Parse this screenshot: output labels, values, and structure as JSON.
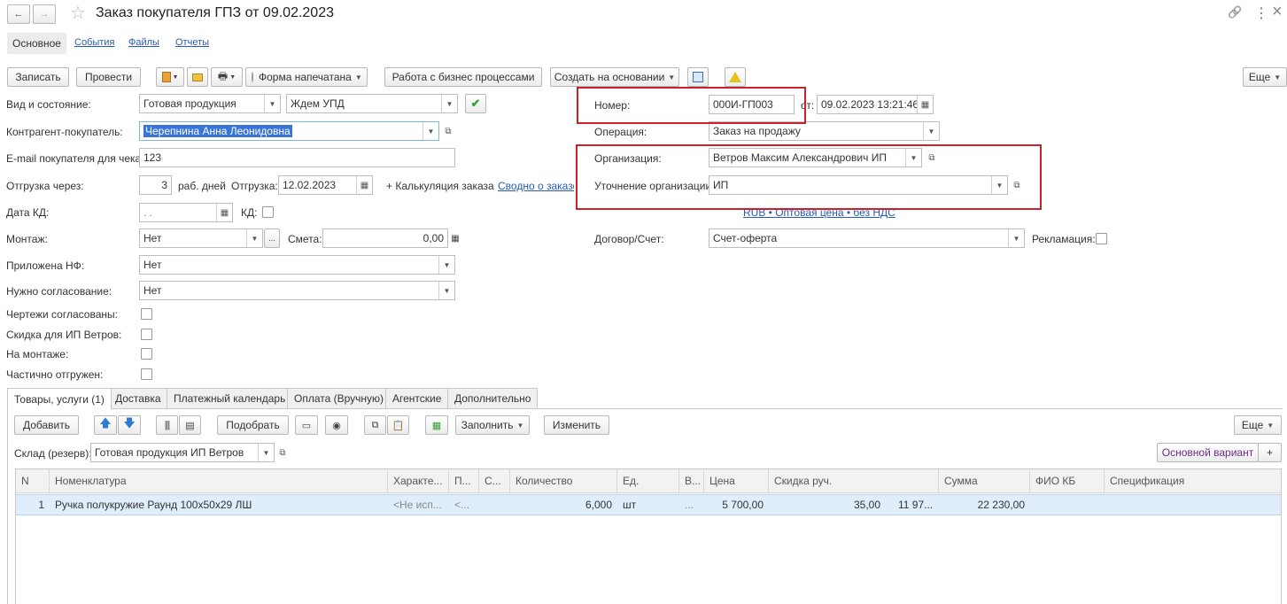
{
  "title": "Заказ покупателя ГПЗ от 09.02.2023",
  "nav": {
    "back": "←",
    "forward": "→",
    "star": "☆",
    "link": "🔗",
    "more": "⋮",
    "close": "×"
  },
  "section_tabs": [
    "Основное",
    "События",
    "Файлы",
    "Отчеты"
  ],
  "toolbar": {
    "write": "Записать",
    "post": "Провести",
    "print_form": "Форма напечатана",
    "business": "Работа с бизнес процессами",
    "create_based": "Создать на основании",
    "more": "Еще"
  },
  "form": {
    "vid_label": "Вид и состояние:",
    "vid_value": "Готовая продукция",
    "state_value": "Ждем УПД",
    "contragent_label": "Контрагент-покупатель:",
    "contragent_value": "Черепнина Анна Леонидовна",
    "email_label": "E-mail покупателя для чека:",
    "email_value": "123",
    "otgr_label": "Отгрузка через:",
    "otgr_days": "3",
    "otgr_days_unit": "раб. дней",
    "otgr_date_label": "Отгрузка:",
    "otgr_date": "12.02.2023",
    "calc_link": "+ Калькуляция заказа",
    "summary_link": "Сводно о заказе",
    "kd_date_label": "Дата КД:",
    "kd_date_value": " .  .",
    "kd_label": "КД:",
    "montazh_label": "Монтаж:",
    "montazh_value": "Нет",
    "smeta_label": "Смета:",
    "smeta_value": "0,00",
    "nf_label": "Приложена НФ:",
    "nf_value": "Нет",
    "soglas_label": "Нужно согласование:",
    "soglas_value": "Нет",
    "chertezhi_label": "Чертежи согласованы:",
    "skidka_label": "Скидка для ИП Ветров:",
    "na_montazhe_label": "На монтаже:",
    "chast_label": "Частично отгружен:",
    "nomer_label": "Номер:",
    "nomer_value": "000И-ГП003",
    "ot_label": "от:",
    "ot_value": "09.02.2023 13:21:46",
    "operation_label": "Операция:",
    "operation_value": "Заказ на продажу",
    "org_label": "Организация:",
    "org_value": "Ветров Максим Александрович ИП",
    "utoch_label": "Уточнение организации:",
    "utoch_value": "ИП",
    "price_link": "RUB • Оптовая цена • без НДС",
    "dogovor_label": "Договор/Счет:",
    "dogovor_value": "Счет-оферта",
    "reklam_label": "Рекламация:"
  },
  "tabs": [
    "Товары, услуги (1)",
    "Доставка",
    "Платежный календарь",
    "Оплата (Вручную)",
    "Агентские",
    "Дополнительно"
  ],
  "items_toolbar": {
    "add": "Добавить",
    "pick": "Подобрать",
    "fill": "Заполнить",
    "change": "Изменить",
    "more": "Еще"
  },
  "sklad": {
    "label": "Склад (резерв):",
    "value": "Готовая продукция ИП Ветров"
  },
  "variant": {
    "label": "Основной вариант",
    "plus": "+"
  },
  "table": {
    "headers": [
      "N",
      "Номенклатура",
      "Характе...",
      "П...",
      "С...",
      "Количество",
      "Ед.",
      "В...",
      "Цена",
      "Скидка руч.",
      "Сумма",
      "ФИО КБ",
      "Спецификация"
    ],
    "rows": [
      {
        "n": "1",
        "nom": "Ручка полукружие Раунд 100х50х29 ЛШ",
        "char": "<Не исп...",
        "p": "<...",
        "c": "",
        "qty": "6,000",
        "unit": "шт",
        "v": "...",
        "price": "5 700,00",
        "disc": "35,00",
        "disc2": "11 97...",
        "sum": "22 230,00",
        "fio": "",
        "spec": ""
      }
    ]
  },
  "colors": {
    "accent_link": "#2a5ab8",
    "highlight_box": "#c6222b",
    "row_selected": "#dfeefa",
    "checkmark": "#3aa13a"
  }
}
